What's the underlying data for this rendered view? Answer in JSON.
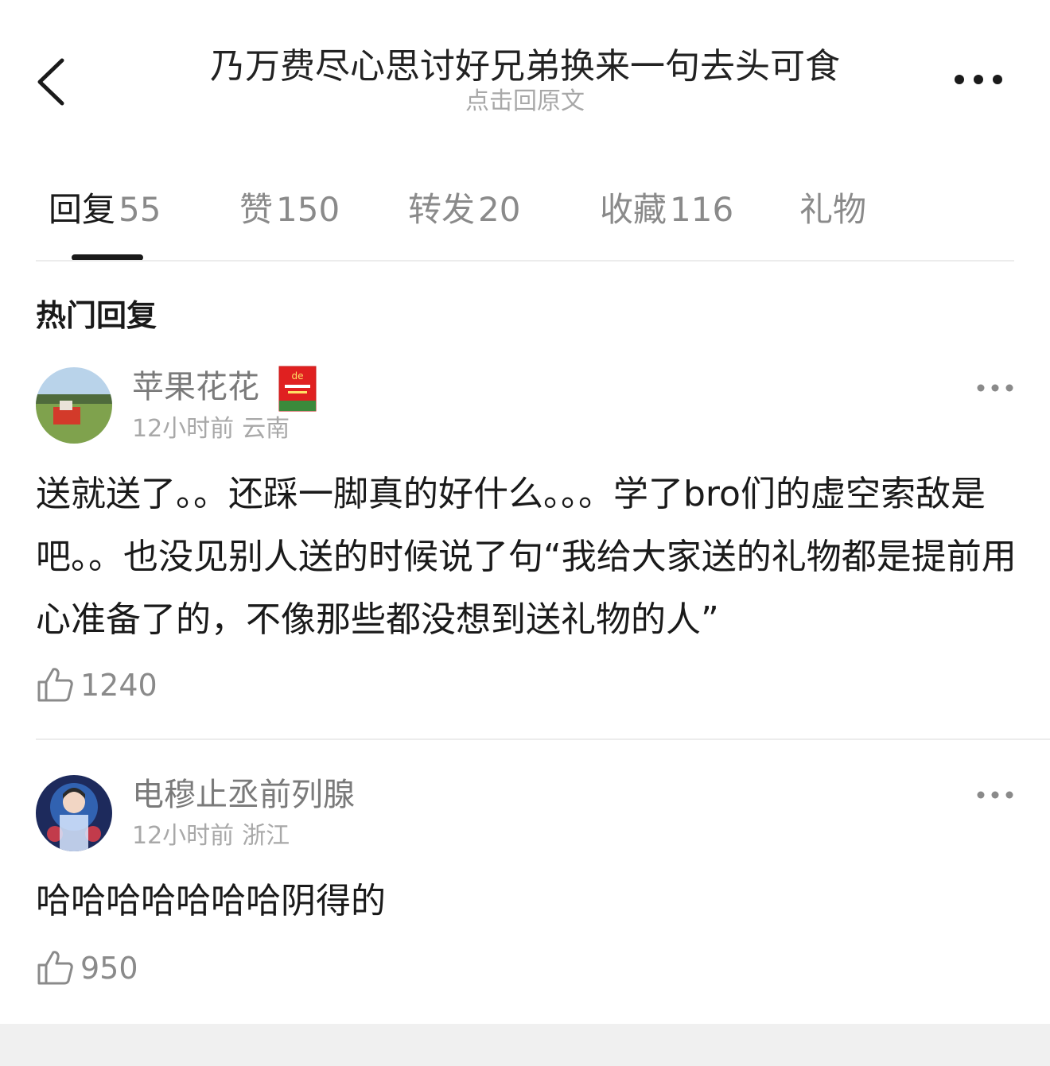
{
  "header": {
    "title": "乃万费尽心思讨好兄弟换来一句去头可食",
    "subtitle": "点击回原文",
    "back_icon": "chevron-left-icon",
    "more_icon": "more-horizontal-icon"
  },
  "tabs": [
    {
      "label": "回复",
      "count": "55",
      "active": true
    },
    {
      "label": "赞",
      "count": "150"
    },
    {
      "label": "转发",
      "count": "20"
    },
    {
      "label": "收藏",
      "count": "116"
    },
    {
      "label": "礼物",
      "count": ""
    }
  ],
  "section_title": "热门回复",
  "comments": [
    {
      "username": "苹果花花",
      "badge_text": "de",
      "time": "12小时前",
      "location": "云南",
      "body": "送就送了。。还踩一脚真的好什么。。。学了bro们的虚空索敌是吧。。也没见别人送的时候说了句“我给大家送的礼物都是提前用心准备了的，不像那些都没想到送礼物的人”",
      "likes": "1240"
    },
    {
      "username": "电穆止丞前列腺",
      "time": "12小时前",
      "location": "浙江",
      "body": "哈哈哈哈哈哈哈阴得的",
      "likes": "950"
    }
  ],
  "colors": {
    "text_primary": "#1a1a1a",
    "text_secondary": "#8a8a8a",
    "text_muted": "#a8a8a8",
    "divider": "#ececec",
    "badge_red": "#e02020"
  }
}
